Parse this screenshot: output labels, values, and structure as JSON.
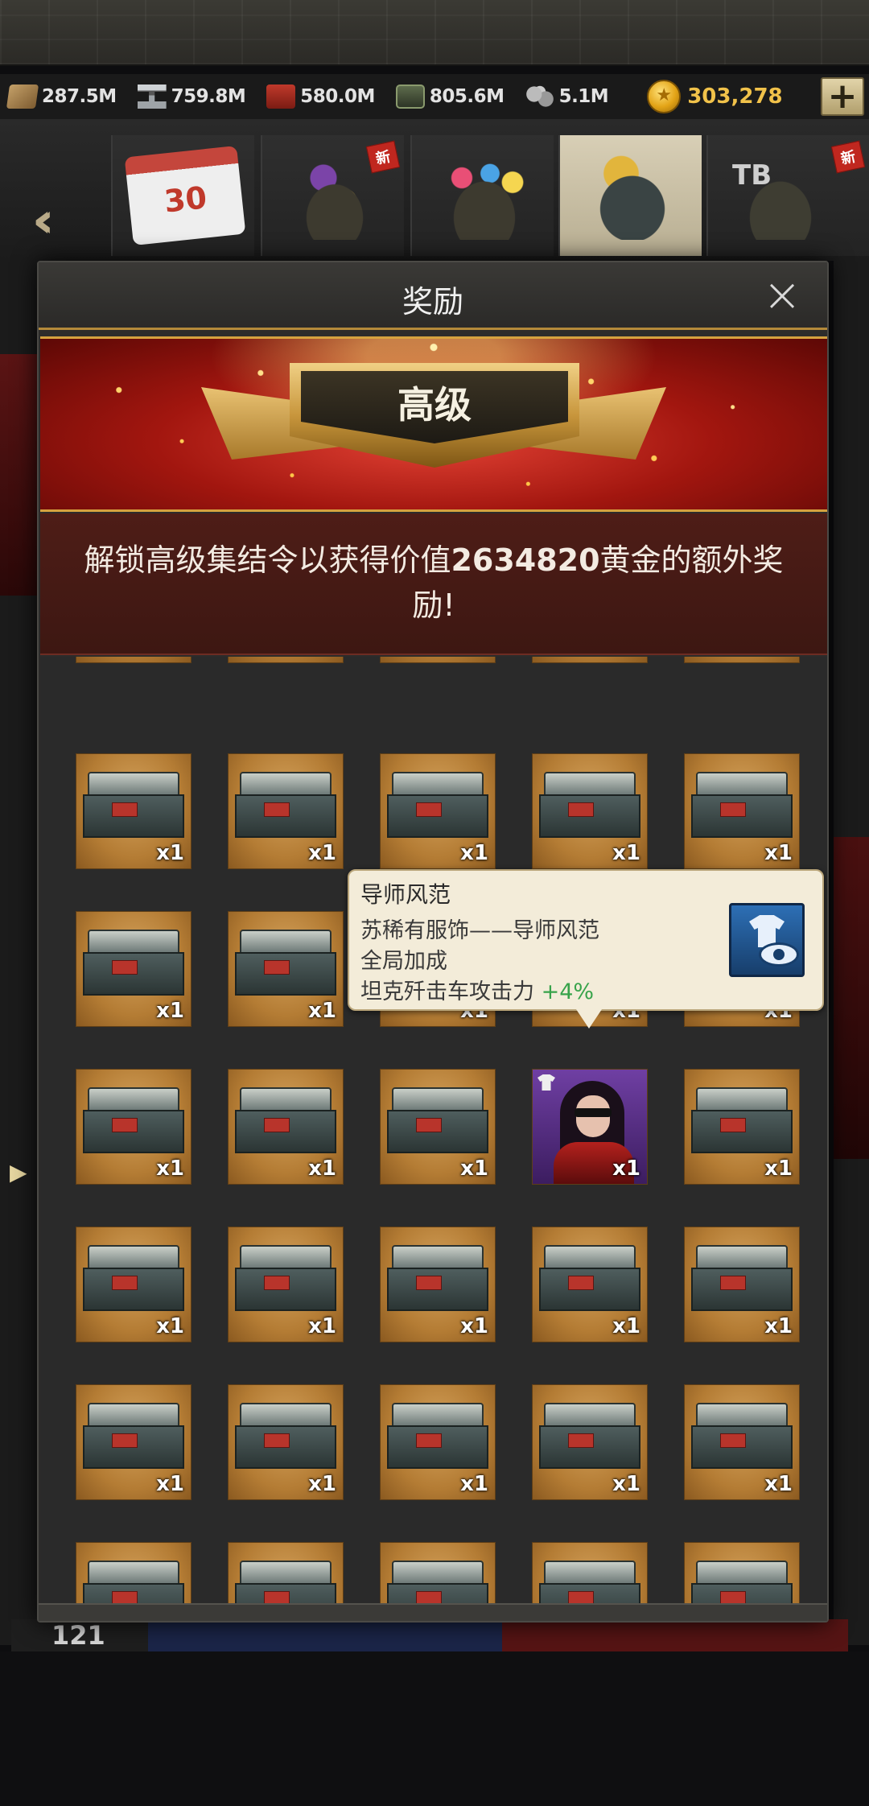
{
  "resources": [
    {
      "icon": "wood-icon",
      "value": "287.5M"
    },
    {
      "icon": "steel-icon",
      "value": "759.8M"
    },
    {
      "icon": "oil-icon",
      "value": "580.0M"
    },
    {
      "icon": "ammo-icon",
      "value": "805.6M"
    },
    {
      "icon": "ore-icon",
      "value": "5.1M"
    }
  ],
  "gold": {
    "value": "303,278",
    "plus_label": "+"
  },
  "event_tabs": [
    {
      "name": "calendar",
      "label": "30"
    },
    {
      "name": "gem-tank",
      "badge": "新"
    },
    {
      "name": "balloon-tank"
    },
    {
      "name": "chest",
      "active": true
    },
    {
      "name": "tb-tank",
      "label": "TB",
      "badge": "新"
    }
  ],
  "modal": {
    "title": "奖励",
    "close_label": "×",
    "rank_title": "高级",
    "notice_prefix": "解锁高级集结令以获得价值",
    "notice_amount": "2634820",
    "notice_suffix": "黄金的额外奖励!"
  },
  "rewards": {
    "quantity_label": "x1",
    "rows": [
      [
        "chest",
        "chest",
        "chest",
        "chest",
        "chest"
      ],
      [
        "chest",
        "chest",
        "chest",
        "chest",
        "chest"
      ],
      [
        "chest",
        "chest",
        "chest",
        "chest",
        "chest"
      ],
      [
        "chest",
        "chest",
        "chest",
        "avatar",
        "chest"
      ],
      [
        "chest",
        "chest",
        "chest",
        "chest",
        "chest"
      ],
      [
        "chest",
        "chest",
        "chest",
        "chest",
        "chest"
      ],
      [
        "chest",
        "chest",
        "chest",
        "chest",
        "chest"
      ]
    ]
  },
  "tooltip": {
    "title": "导师风范",
    "line1": "苏稀有服饰——导师风范",
    "line2": "全局加成",
    "line3_text": "坦克歼击车攻击力",
    "line3_bonus": "+4%",
    "bonus_color": "#37a34a"
  },
  "background": {
    "footer_number": "121"
  }
}
